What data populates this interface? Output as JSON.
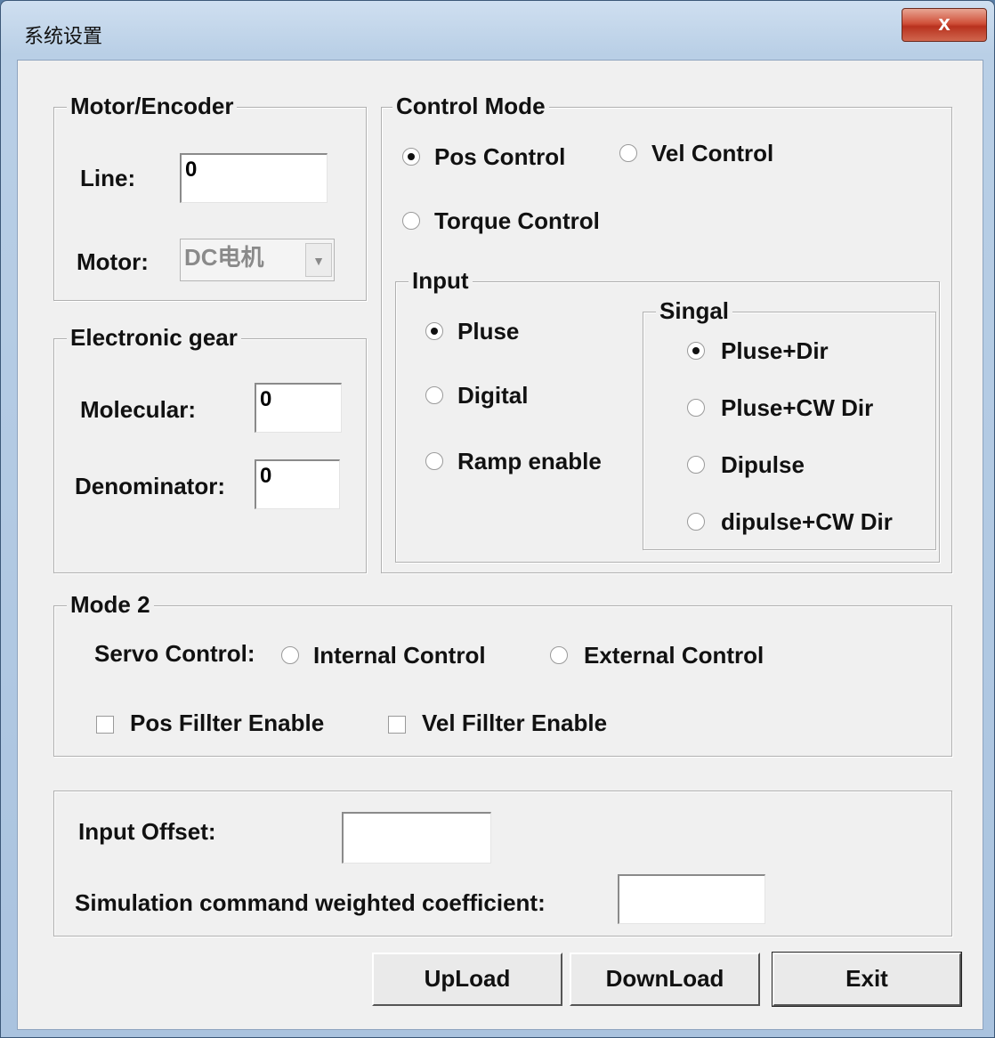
{
  "window": {
    "title": "系统设置",
    "close_label": "x"
  },
  "motor_encoder": {
    "legend": "Motor/Encoder",
    "line_label": "Line:",
    "line_value": "0",
    "motor_label": "Motor:",
    "motor_value": "DC电机",
    "motor_arrow": "▼"
  },
  "electronic_gear": {
    "legend": "Electronic gear",
    "molecular_label": "Molecular:",
    "molecular_value": "0",
    "denominator_label": "Denominator:",
    "denominator_value": "0"
  },
  "control_mode": {
    "legend": "Control Mode",
    "options": [
      {
        "label": "Pos Control",
        "selected": true
      },
      {
        "label": "Vel Control",
        "selected": false
      },
      {
        "label": "Torque Control",
        "selected": false
      }
    ],
    "input": {
      "legend": "Input",
      "options": [
        {
          "label": "Pluse",
          "selected": true
        },
        {
          "label": "Digital",
          "selected": false
        },
        {
          "label": "Ramp enable",
          "selected": false
        }
      ]
    },
    "signal": {
      "legend": "Singal",
      "options": [
        {
          "label": "Pluse+Dir",
          "selected": true
        },
        {
          "label": "Pluse+CW Dir",
          "selected": false
        },
        {
          "label": "Dipulse",
          "selected": false
        },
        {
          "label": "dipulse+CW Dir",
          "selected": false
        }
      ]
    }
  },
  "mode2": {
    "legend": "Mode 2",
    "servo_label": "Servo Control:",
    "internal_label": "Internal Control",
    "external_label": "External Control",
    "pos_filter_label": "Pos Fillter Enable",
    "vel_filter_label": "Vel Fillter Enable"
  },
  "offsets": {
    "input_offset_label": "Input Offset:",
    "input_offset_value": "",
    "sim_coef_label": "Simulation command weighted coefficient:",
    "sim_coef_value": ""
  },
  "buttons": {
    "upload": "UpLoad",
    "download": "DownLoad",
    "exit": "Exit"
  }
}
